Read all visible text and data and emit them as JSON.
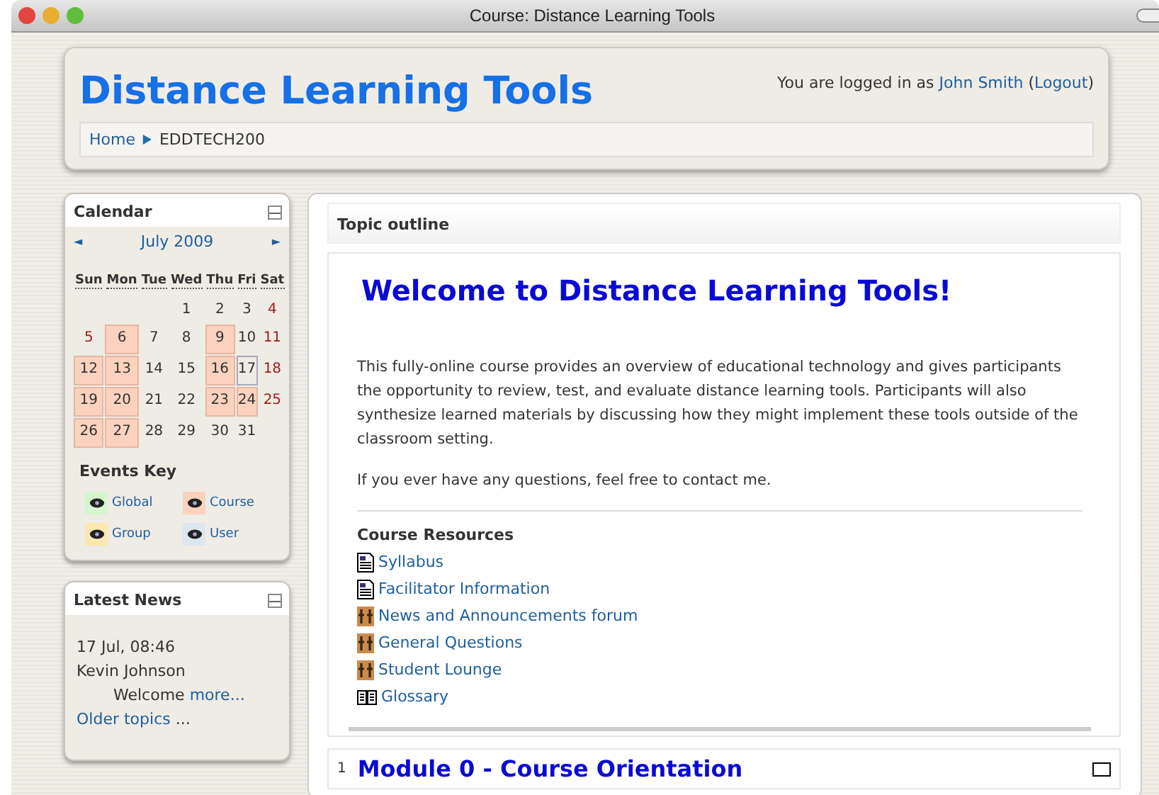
{
  "window": {
    "title": "Course: Distance Learning Tools"
  },
  "header": {
    "site_title": "Distance Learning Tools",
    "login_prefix": "You are logged in as",
    "user": "John Smith",
    "logout": "Logout",
    "paren_open": "(",
    "paren_close": ")",
    "breadcrumb": [
      {
        "label": "Home",
        "link": true
      },
      {
        "label": "EDDTECH200",
        "link": false
      }
    ]
  },
  "calendar": {
    "title": "Calendar",
    "month": "July 2009",
    "prev": "◄",
    "next": "►",
    "weekdays": [
      "Sun",
      "Mon",
      "Tue",
      "Wed",
      "Thu",
      "Fri",
      "Sat"
    ],
    "weeks": [
      {
        "starts_midweek": true,
        "days": [
          {
            "day": "1",
            "event": false,
            "today": false,
            "weekend": false
          },
          {
            "day": "2",
            "event": false,
            "today": false,
            "weekend": false
          },
          {
            "day": "3",
            "event": false,
            "today": false,
            "weekend": false
          },
          {
            "day": "4",
            "event": false,
            "today": false,
            "weekend": true
          }
        ]
      },
      {
        "starts_midweek": false,
        "days": [
          {
            "day": "5",
            "event": false,
            "today": false,
            "weekend": true
          },
          {
            "day": "6",
            "event": true,
            "today": false,
            "weekend": false
          },
          {
            "day": "7",
            "event": false,
            "today": false,
            "weekend": false
          },
          {
            "day": "8",
            "event": false,
            "today": false,
            "weekend": false
          },
          {
            "day": "9",
            "event": true,
            "today": false,
            "weekend": false
          },
          {
            "day": "10",
            "event": false,
            "today": false,
            "weekend": false
          },
          {
            "day": "11",
            "event": false,
            "today": false,
            "weekend": true
          }
        ]
      },
      {
        "starts_midweek": false,
        "days": [
          {
            "day": "12",
            "event": true,
            "today": false,
            "weekend": true
          },
          {
            "day": "13",
            "event": true,
            "today": false,
            "weekend": false
          },
          {
            "day": "14",
            "event": false,
            "today": false,
            "weekend": false
          },
          {
            "day": "15",
            "event": false,
            "today": false,
            "weekend": false
          },
          {
            "day": "16",
            "event": true,
            "today": false,
            "weekend": false
          },
          {
            "day": "17",
            "event": false,
            "today": true,
            "weekend": false
          },
          {
            "day": "18",
            "event": false,
            "today": false,
            "weekend": true
          }
        ]
      },
      {
        "starts_midweek": false,
        "days": [
          {
            "day": "19",
            "event": true,
            "today": false,
            "weekend": true
          },
          {
            "day": "20",
            "event": true,
            "today": false,
            "weekend": false
          },
          {
            "day": "21",
            "event": false,
            "today": false,
            "weekend": false
          },
          {
            "day": "22",
            "event": false,
            "today": false,
            "weekend": false
          },
          {
            "day": "23",
            "event": true,
            "today": false,
            "weekend": false
          },
          {
            "day": "24",
            "event": true,
            "today": false,
            "weekend": false
          },
          {
            "day": "25",
            "event": false,
            "today": false,
            "weekend": true
          }
        ]
      },
      {
        "starts_midweek": false,
        "days": [
          {
            "day": "26",
            "event": true,
            "today": false,
            "weekend": true
          },
          {
            "day": "27",
            "event": true,
            "today": false,
            "weekend": false
          },
          {
            "day": "28",
            "event": false,
            "today": false,
            "weekend": false
          },
          {
            "day": "29",
            "event": false,
            "today": false,
            "weekend": false
          },
          {
            "day": "30",
            "event": false,
            "today": false,
            "weekend": false
          },
          {
            "day": "31",
            "event": false,
            "today": false,
            "weekend": false
          }
        ]
      }
    ],
    "events_key_title": "Events Key",
    "events_key": [
      {
        "label": "Global",
        "color": "#d6f5d0"
      },
      {
        "label": "Course",
        "color": "#fbd2bd"
      },
      {
        "label": "Group",
        "color": "#fbe8b0"
      },
      {
        "label": "User",
        "color": "#dce6ee"
      }
    ]
  },
  "news": {
    "title": "Latest News",
    "date": "17 Jul, 08:46",
    "author": "Kevin Johnson",
    "subject": "Welcome",
    "more": "more...",
    "older": "Older topics",
    "older_suffix": "..."
  },
  "main": {
    "outline_title": "Topic outline",
    "welcome": "Welcome to Distance Learning Tools!",
    "paragraphs": [
      "This fully-online course provides an overview of educational technology and gives participants the opportunity to review, test, and evaluate distance learning tools. Participants will also synthesize learned materials by discussing how they might implement these tools outside of the classroom setting.",
      "If you ever have any questions, feel free to contact me."
    ],
    "resources_title": "Course Resources",
    "resources": [
      {
        "label": "Syllabus",
        "kind": "page"
      },
      {
        "label": "Facilitator Information",
        "kind": "page"
      },
      {
        "label": "News and Announcements forum",
        "kind": "forum"
      },
      {
        "label": "General Questions",
        "kind": "forum"
      },
      {
        "label": "Student Lounge",
        "kind": "forum"
      },
      {
        "label": "Glossary",
        "kind": "glossary"
      }
    ],
    "sections": [
      {
        "number": "1",
        "title": "Module 0 - Course Orientation"
      }
    ]
  }
}
